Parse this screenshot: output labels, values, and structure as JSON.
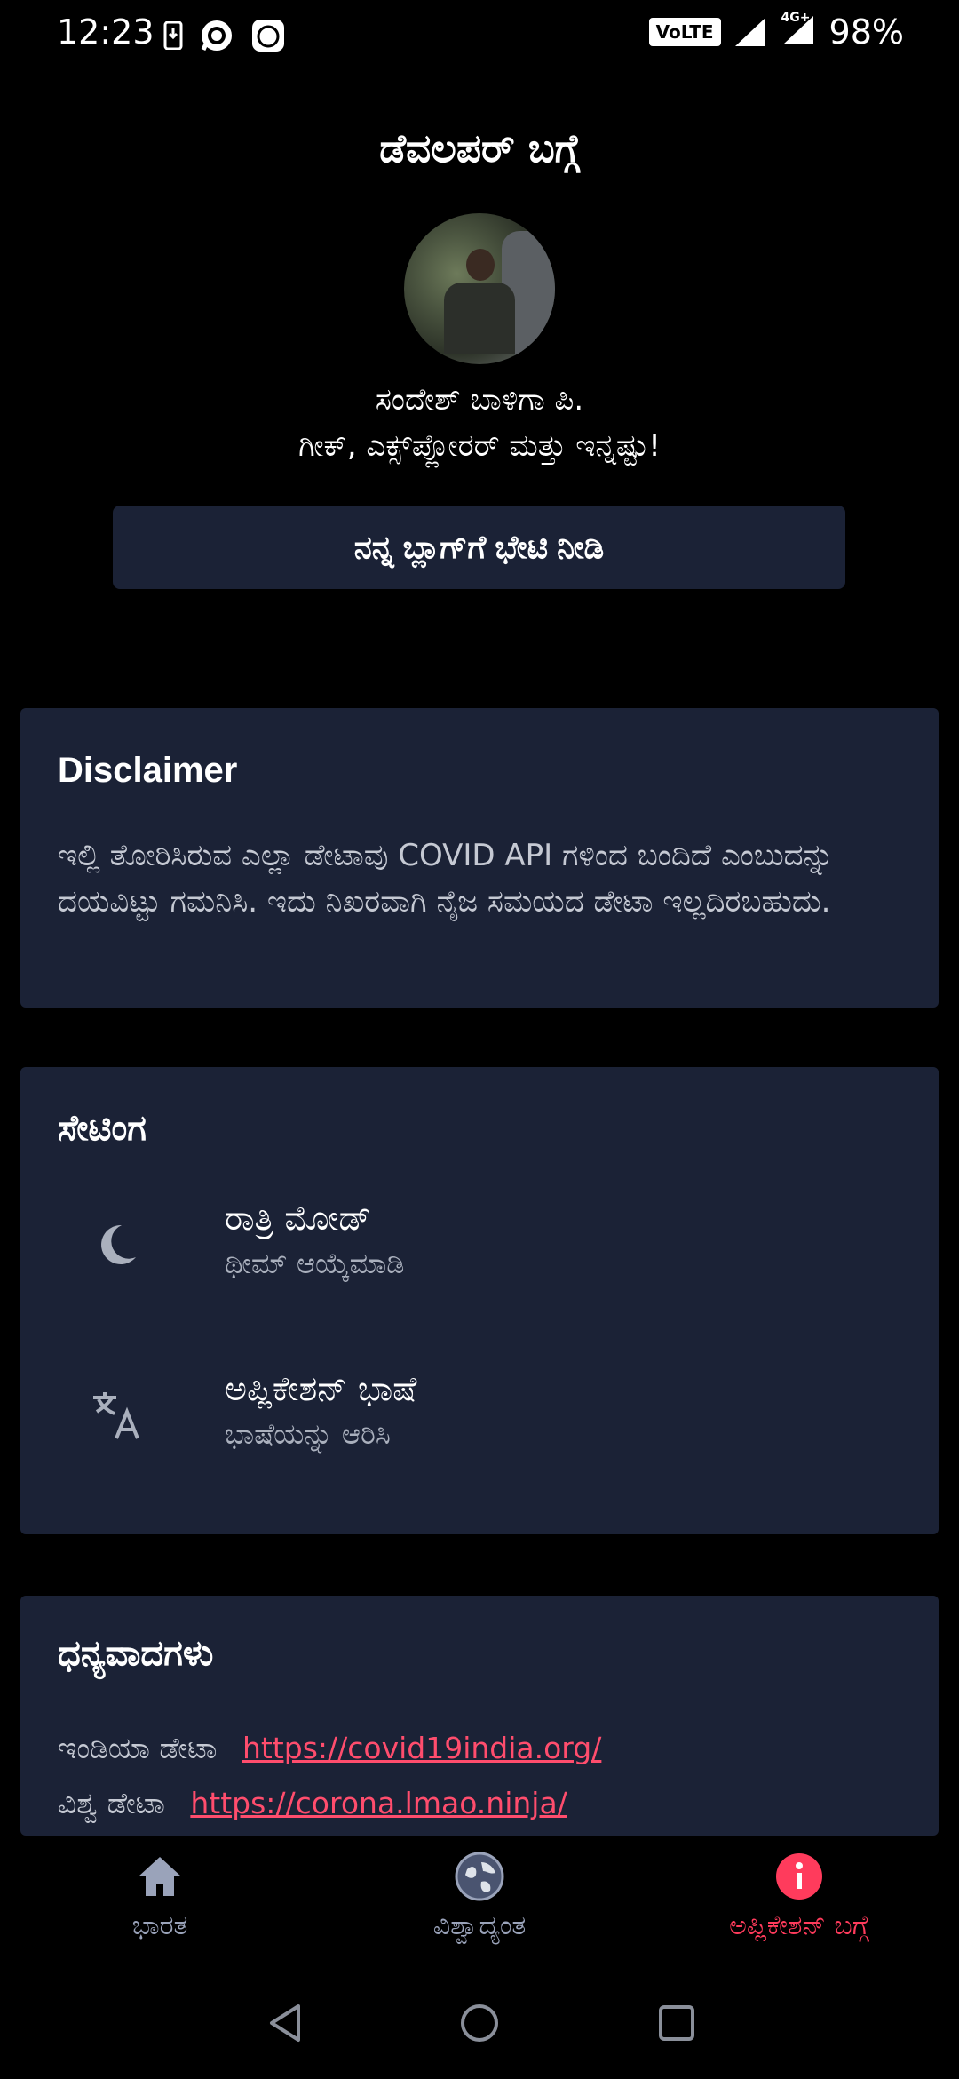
{
  "status_bar": {
    "time": "12:23",
    "network_badge": "VoLTE",
    "network_type": "4G+",
    "battery": "98%"
  },
  "header": {
    "title": "ಡೆವಲಪರ್ ಬಗ್ಗೆ",
    "name": "ಸಂದೇಶ್ ಬಾಳಿಗಾ ಪಿ.",
    "tagline": "ಗೀಕ್, ಎಕ್ಸ್‌ಪ್ಲೋರರ್ ಮತ್ತು ಇನ್ನಷ್ಟು!",
    "blog_button": "ನನ್ನ ಬ್ಲಾಗ್‌ಗೆ ಭೇಟಿ ನೀಡಿ"
  },
  "disclaimer": {
    "title": "Disclaimer",
    "text": "ಇಲ್ಲಿ ತೋರಿಸಿರುವ ಎಲ್ಲಾ ಡೇಟಾವು COVID API ಗಳಿಂದ ಬಂದಿದೆ ಎಂಬುದನ್ನು ದಯವಿಟ್ಟು ಗಮನಿಸಿ. ಇದು ನಿಖರವಾಗಿ ನೈಜ ಸಮಯದ ಡೇಟಾ ಇಲ್ಲದಿರಬಹುದು."
  },
  "settings": {
    "title": "ಸೇಟಿಂಗ",
    "items": [
      {
        "title": "ರಾತ್ರಿ ಮೋಡ್",
        "subtitle": "ಥೀಮ್ ಆಯ್ಕೆಮಾಡಿ",
        "icon": "moon-icon"
      },
      {
        "title": "ಅಪ್ಲಿಕೇಶನ್ ಭಾಷೆ",
        "subtitle": "ಭಾಷೆಯನ್ನು ಆರಿಸಿ",
        "icon": "translate-icon"
      }
    ]
  },
  "thanks": {
    "title": "ಧನ್ಯವಾದಗಳು",
    "rows": [
      {
        "label": "ಇಂಡಿಯಾ ಡೇಟಾ",
        "link": "https://covid19india.org/"
      },
      {
        "label": "ವಿಶ್ವ ಡೇಟಾ",
        "link": "https://corona.lmao.ninja/"
      }
    ]
  },
  "bottom_nav": {
    "items": [
      {
        "label": "ಭಾರತ",
        "icon": "home-icon"
      },
      {
        "label": "ವಿಶ್ವಾದ್ಯಂತ",
        "icon": "globe-icon"
      },
      {
        "label": "ಅಪ್ಲಿಕೇಶನ್ ಬಗ್ಗೆ",
        "icon": "info-icon",
        "active": true
      }
    ]
  },
  "colors": {
    "background": "#000000",
    "card": "#1b2236",
    "accent": "#ff3b5c",
    "link": "#ff4d6d",
    "inactive": "#9aa3ba"
  }
}
